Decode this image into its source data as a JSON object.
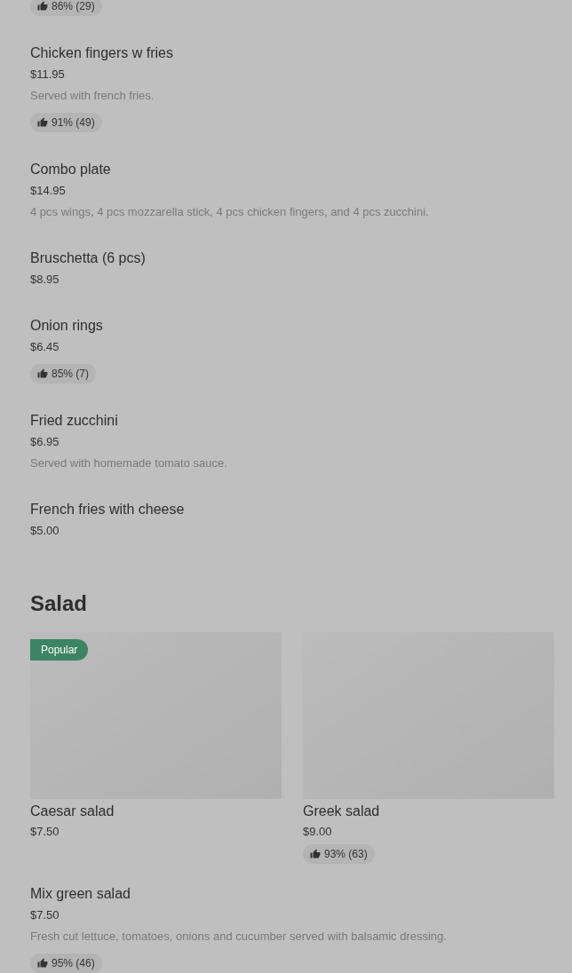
{
  "items": [
    {
      "rating": "86% (29)"
    },
    {
      "name": "Chicken fingers w fries",
      "price": "$11.95",
      "description": "Served with french fries.",
      "rating": "91% (49)"
    },
    {
      "name": "Combo plate",
      "price": "$14.95",
      "description": "4 pcs wings, 4 pcs mozzarella stick, 4 pcs chicken fingers, and 4 pcs zucchini."
    },
    {
      "name": "Bruschetta (6 pcs)",
      "price": "$8.95"
    },
    {
      "name": "Onion rings",
      "price": "$6.45",
      "rating": "85% (7)"
    },
    {
      "name": "Fried zucchini",
      "price": "$6.95",
      "description": "Served with homemade tomato sauce."
    },
    {
      "name": "French fries with cheese",
      "price": "$5.00"
    }
  ],
  "salad_section": {
    "title": "Salad",
    "featured": [
      {
        "name": "Caesar salad",
        "price": "$7.50",
        "badge": "Popular"
      },
      {
        "name": "Greek salad",
        "price": "$9.00",
        "rating": "93% (63)"
      }
    ],
    "items": [
      {
        "name": "Mix green salad",
        "price": "$7.50",
        "description": "Fresh cut lettuce, tomatoes, onions and cucumber served with balsamic dressing.",
        "rating": "95% (46)"
      }
    ]
  }
}
